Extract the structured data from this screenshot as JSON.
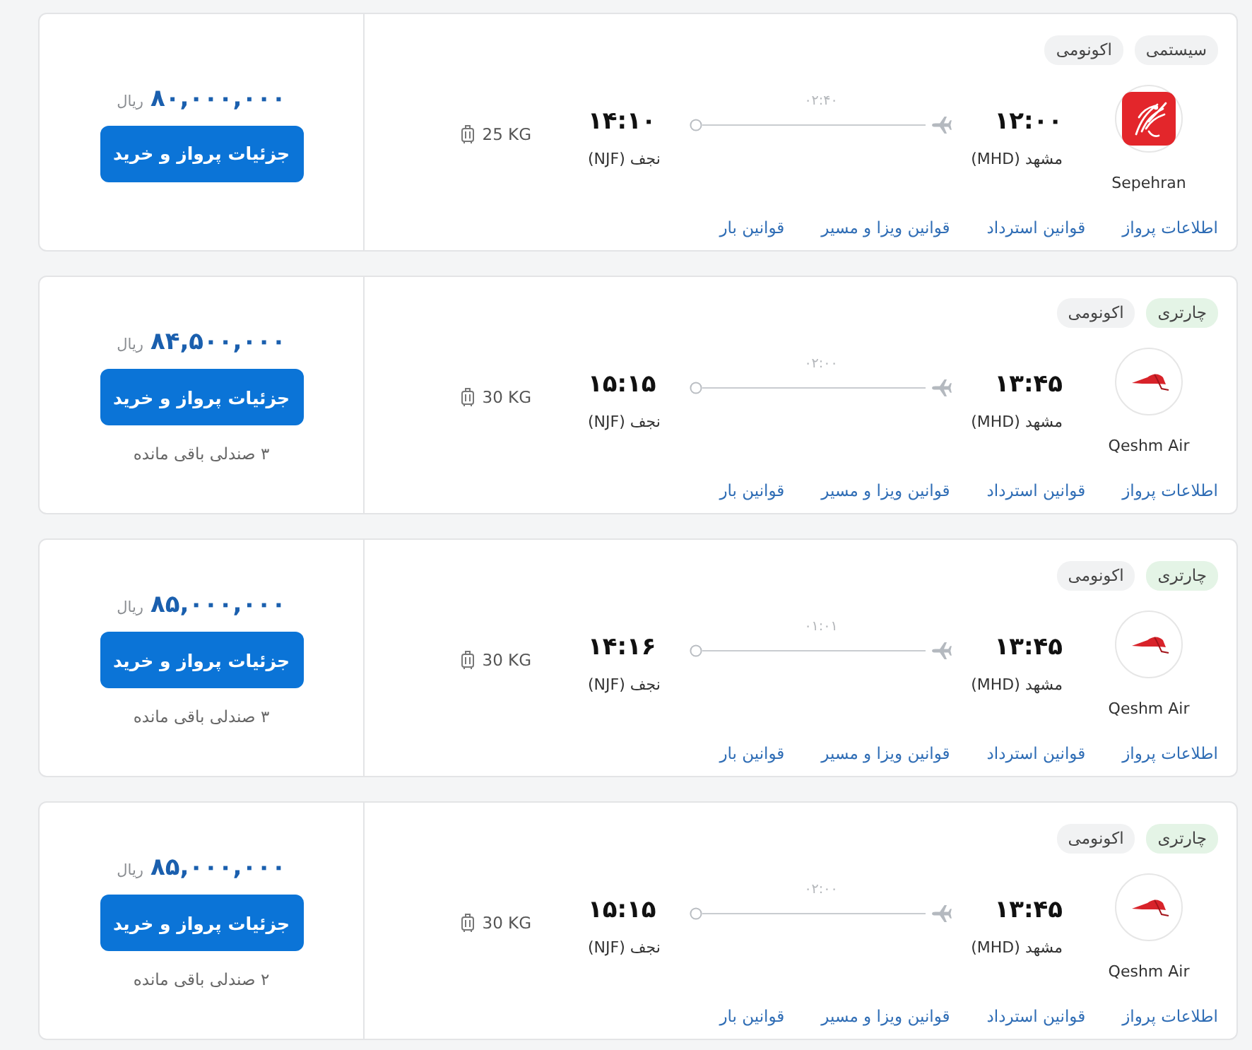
{
  "flights": [
    {
      "tags": [
        {
          "label": "سیستمی",
          "color": "#f1f2f3"
        },
        {
          "label": "اکونومی",
          "color": "#f1f2f3"
        }
      ],
      "airline": {
        "name": "Sepehran",
        "kind": "tile"
      },
      "departure": {
        "time": "۱۲:۰۰",
        "city": "مشهد (MHD)"
      },
      "duration": "۰۲:۴۰",
      "arrival": {
        "time": "۱۴:۱۰",
        "city": "نجف (NJF)"
      },
      "baggage": "25 KG",
      "links": [
        "اطلاعات پرواز",
        "قوانین استرداد",
        "قوانین ویزا و مسیر",
        "قوانین بار"
      ],
      "price": "۸۰,۰۰۰,۰۰۰",
      "currency": "ریال",
      "button": "جزئیات پرواز و خرید"
    },
    {
      "tags": [
        {
          "label": "چارتری",
          "color": "#e4f4e6"
        },
        {
          "label": "اکونومی",
          "color": "#f1f2f3"
        }
      ],
      "airline": {
        "name": "Qeshm Air",
        "kind": "wing"
      },
      "departure": {
        "time": "۱۳:۴۵",
        "city": "مشهد (MHD)"
      },
      "duration": "۰۲:۰۰",
      "arrival": {
        "time": "۱۵:۱۵",
        "city": "نجف (NJF)"
      },
      "baggage": "30 KG",
      "links": [
        "اطلاعات پرواز",
        "قوانین استرداد",
        "قوانین ویزا و مسیر",
        "قوانین بار"
      ],
      "price": "۸۴,۵۰۰,۰۰۰",
      "currency": "ریال",
      "button": "جزئیات پرواز و خرید",
      "seats": "۳ صندلی باقی مانده"
    },
    {
      "tags": [
        {
          "label": "چارتری",
          "color": "#e4f4e6"
        },
        {
          "label": "اکونومی",
          "color": "#f1f2f3"
        }
      ],
      "airline": {
        "name": "Qeshm Air",
        "kind": "wing"
      },
      "departure": {
        "time": "۱۳:۴۵",
        "city": "مشهد (MHD)"
      },
      "duration": "۰۱:۰۱",
      "arrival": {
        "time": "۱۴:۱۶",
        "city": "نجف (NJF)"
      },
      "baggage": "30 KG",
      "links": [
        "اطلاعات پرواز",
        "قوانین استرداد",
        "قوانین ویزا و مسیر",
        "قوانین بار"
      ],
      "price": "۸۵,۰۰۰,۰۰۰",
      "currency": "ریال",
      "button": "جزئیات پرواز و خرید",
      "seats": "۳ صندلی باقی مانده"
    },
    {
      "tags": [
        {
          "label": "چارتری",
          "color": "#e4f4e6"
        },
        {
          "label": "اکونومی",
          "color": "#f1f2f3"
        }
      ],
      "airline": {
        "name": "Qeshm Air",
        "kind": "wing"
      },
      "departure": {
        "time": "۱۳:۴۵",
        "city": "مشهد (MHD)"
      },
      "duration": "۰۲:۰۰",
      "arrival": {
        "time": "۱۵:۱۵",
        "city": "نجف (NJF)"
      },
      "baggage": "30 KG",
      "links": [
        "اطلاعات پرواز",
        "قوانین استرداد",
        "قوانین ویزا و مسیر",
        "قوانین بار"
      ],
      "price": "۸۵,۰۰۰,۰۰۰",
      "currency": "ریال",
      "button": "جزئیات پرواز و خرید",
      "seats": "۲ صندلی باقی مانده"
    }
  ]
}
